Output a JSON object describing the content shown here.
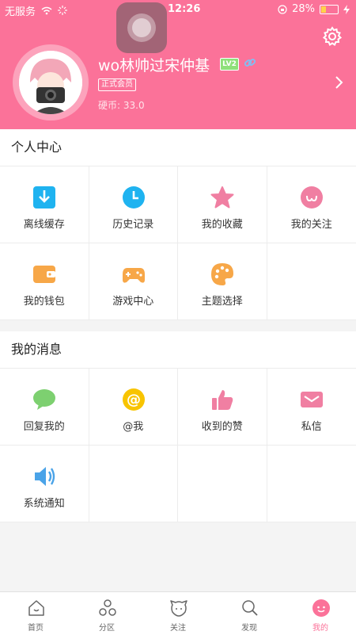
{
  "status_bar": {
    "carrier": "无服务",
    "time": "12:26",
    "battery_percent": "28%",
    "battery_level": 0.28
  },
  "profile": {
    "username": "wo林帅过宋仲基",
    "level": "LV2",
    "member_tag": "正式会员",
    "coins": "硬币: 33.0"
  },
  "personal_center": {
    "title": "个人中心",
    "items": [
      {
        "label": "离线缓存",
        "icon": "download-icon",
        "color": "#1fb3f0"
      },
      {
        "label": "历史记录",
        "icon": "clock-icon",
        "color": "#1fb3f0"
      },
      {
        "label": "我的收藏",
        "icon": "star-icon",
        "color": "#f07fa2"
      },
      {
        "label": "我的关注",
        "icon": "face-icon",
        "color": "#f07fa2"
      },
      {
        "label": "我的钱包",
        "icon": "wallet-icon",
        "color": "#f7a748"
      },
      {
        "label": "游戏中心",
        "icon": "gamepad-icon",
        "color": "#f7a748"
      },
      {
        "label": "主题选择",
        "icon": "palette-icon",
        "color": "#f7a748"
      }
    ]
  },
  "my_messages": {
    "title": "我的消息",
    "items": [
      {
        "label": "回复我的",
        "icon": "chat-bubble-icon",
        "color": "#7dd070"
      },
      {
        "label": "@我",
        "icon": "at-icon",
        "color": "#f8c400"
      },
      {
        "label": "收到的赞",
        "icon": "thumbs-up-icon",
        "color": "#f07fa2"
      },
      {
        "label": "私信",
        "icon": "mail-icon",
        "color": "#f07fa2"
      },
      {
        "label": "系统通知",
        "icon": "speaker-icon",
        "color": "#4aa3e8"
      }
    ]
  },
  "tabs": [
    {
      "label": "首页",
      "icon": "home-icon"
    },
    {
      "label": "分区",
      "icon": "categories-icon"
    },
    {
      "label": "关注",
      "icon": "follow-icon"
    },
    {
      "label": "发现",
      "icon": "search-icon"
    },
    {
      "label": "我的",
      "icon": "mine-icon",
      "active": true
    }
  ],
  "colors": {
    "brand_pink": "#fb7299",
    "background": "#f4f4f4"
  }
}
